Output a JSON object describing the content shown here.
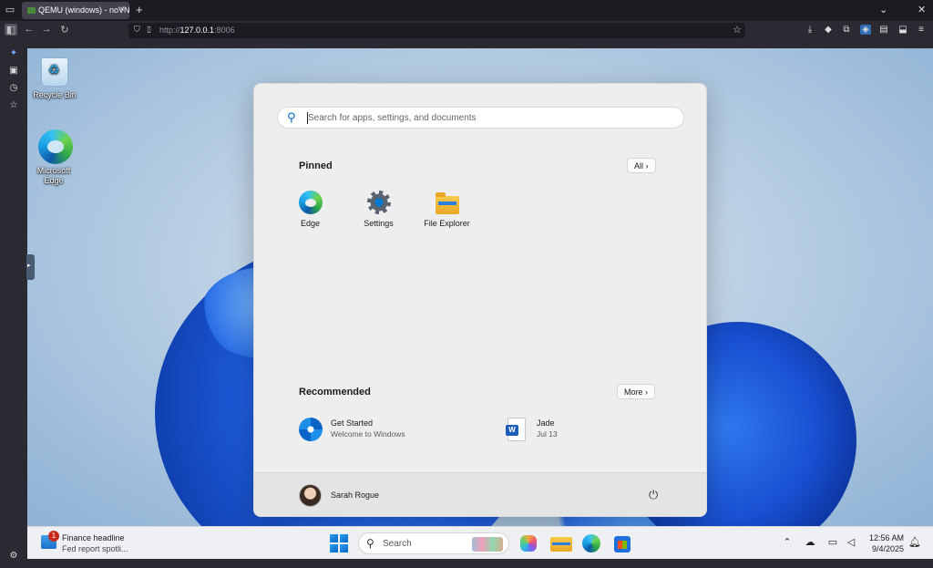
{
  "browser": {
    "tab_title": "QEMU (windows) - noVNC",
    "tab_close": "×",
    "new_tab": "+",
    "url_prefix": "http://",
    "url_host": "127.0.0.1",
    "url_port": ":8006",
    "window_controls": {
      "list": "⌄",
      "close": "✕"
    }
  },
  "desktop": {
    "icons": [
      {
        "label": "Recycle Bin"
      },
      {
        "label": "Microsoft Edge"
      }
    ]
  },
  "start_menu": {
    "search_placeholder": "Search for apps, settings, and documents",
    "pinned_title": "Pinned",
    "all_button": "All",
    "pinned_apps": [
      {
        "label": "Edge",
        "icon": "edge-icon"
      },
      {
        "label": "Settings",
        "icon": "gear-icon"
      },
      {
        "label": "File Explorer",
        "icon": "folder-icon"
      }
    ],
    "recommended_title": "Recommended",
    "more_button": "More",
    "recommended": [
      {
        "title": "Get Started",
        "subtitle": "Welcome to Windows",
        "icon": "get-started-icon"
      },
      {
        "title": "Jade",
        "subtitle": "Jul 13",
        "icon": "word-doc-icon"
      }
    ],
    "user_name": "Sarah Rogue",
    "power_icon": "power-icon"
  },
  "taskbar": {
    "widget_badge": "1",
    "widget_title": "Finance headline",
    "widget_subtitle": "Fed report spotli...",
    "search_label": "Search",
    "time": "12:56 AM",
    "date": "9/4/2025"
  }
}
